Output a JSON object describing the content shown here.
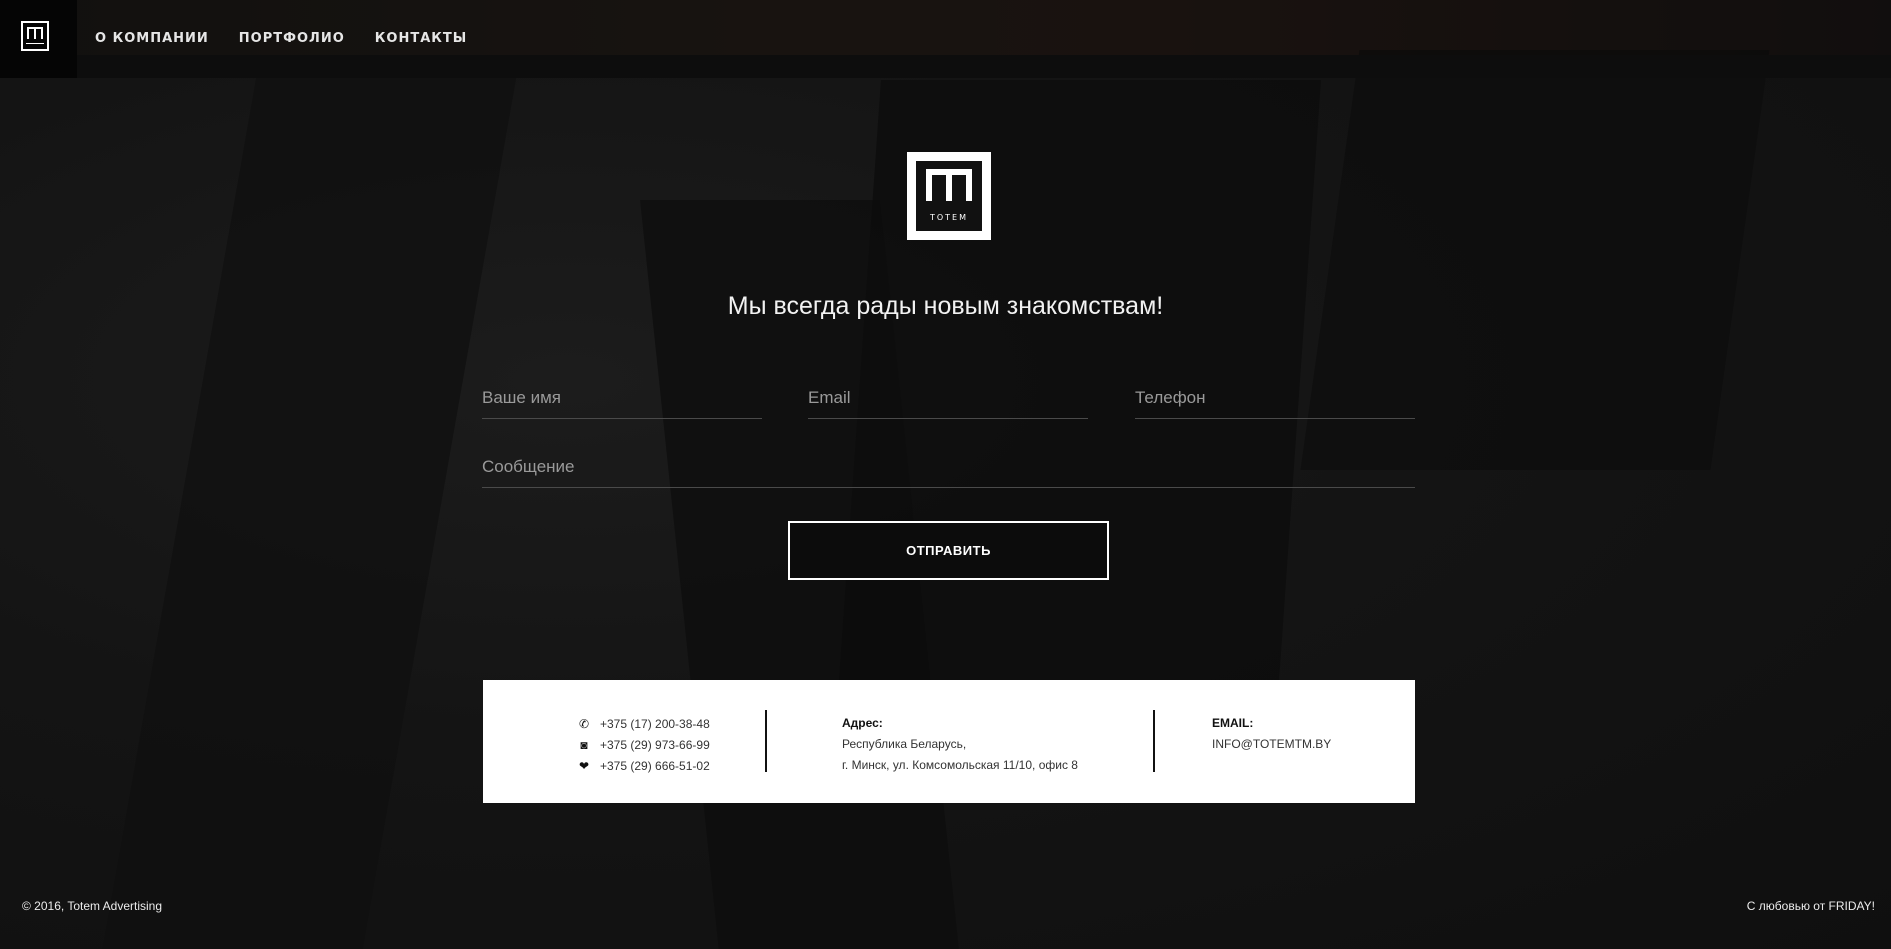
{
  "header": {
    "logo_word": "TOTEM",
    "nav": [
      "О КОМПАНИИ",
      "ПОРТФОЛИО",
      "КОНТАКТЫ"
    ]
  },
  "hero": {
    "logo_word": "TOTEM",
    "tagline": "Мы всегда рады новым знакомствам!"
  },
  "form": {
    "name_placeholder": "Ваше имя",
    "email_placeholder": "Email",
    "phone_placeholder": "Телефон",
    "message_placeholder": "Сообщение",
    "submit_label": "ОТПРАВИТЬ"
  },
  "contacts": {
    "phones": [
      {
        "icon": "phone-icon",
        "number": "+375 (17) 200-38-48"
      },
      {
        "icon": "velcom-icon",
        "number": "+375 (29) 973-66-99"
      },
      {
        "icon": "mts-icon",
        "number": "+375 (29) 666-51-02"
      }
    ],
    "address_label": "Адрес:",
    "address_line1": "Республика Беларусь,",
    "address_line2": "г. Минск, ул. Комсомольская 11/10, офис 8",
    "email_label": "EMAIL:",
    "email": "INFO@TOTEMTM.BY"
  },
  "footer": {
    "copyright": "© 2016, Totem Advertising",
    "credit": "С любовью от FRIDAY!"
  }
}
